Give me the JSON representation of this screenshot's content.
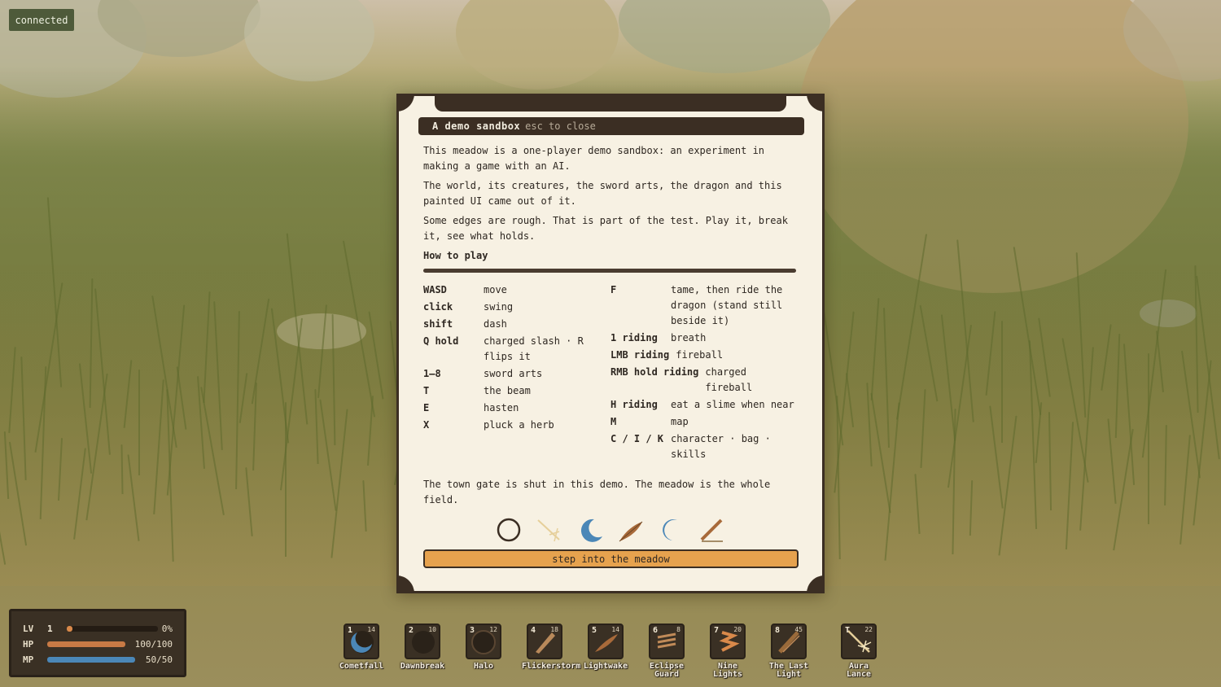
{
  "status": {
    "connection": "connected"
  },
  "dialog": {
    "title": "A demo sandbox",
    "close_hint": "esc to close",
    "paragraphs": [
      "This meadow is a one-player demo sandbox: an experiment in making a game with an AI.",
      "The world, its creatures, the sword arts, the dragon and this painted UI came out of it.",
      "Some edges are rough. That is part of the test. Play it, break it, see what holds."
    ],
    "howto_heading": "How to play",
    "controls_left": [
      {
        "key": "WASD",
        "desc": "move"
      },
      {
        "key": "click",
        "desc": "swing"
      },
      {
        "key": "shift",
        "desc": "dash"
      },
      {
        "key": "Q hold",
        "desc": "charged slash · R flips it"
      },
      {
        "key": "1–8",
        "desc": "sword arts"
      },
      {
        "key": "T",
        "desc": "the beam"
      },
      {
        "key": "E",
        "desc": "hasten"
      },
      {
        "key": "X",
        "desc": "pluck a herb"
      }
    ],
    "controls_right": [
      {
        "key": "F",
        "desc": "tame, then ride the dragon (stand still beside it)"
      },
      {
        "key": "1 riding",
        "desc": "breath"
      },
      {
        "key": "LMB riding",
        "desc": "fireball"
      },
      {
        "key": "RMB hold riding",
        "desc": "charged fireball"
      },
      {
        "key": "H riding",
        "desc": "eat a slime when near"
      },
      {
        "key": "M",
        "desc": "map"
      },
      {
        "key": "C / I / K",
        "desc": "character · bag · skills"
      }
    ],
    "footer": "The town gate is shut in this demo. The meadow is the whole field.",
    "icons": [
      "ring-icon",
      "starburst-icon",
      "crescent-icon",
      "feather-icon",
      "crescent-blue-icon",
      "quill-icon"
    ],
    "button": "step into the meadow"
  },
  "stats": {
    "level_label": "LV",
    "level": "1",
    "xp_percent": 0,
    "xp_text": "0%",
    "hp_label": "HP",
    "hp_text": "100/100",
    "hp_fraction": 1,
    "mp_label": "MP",
    "mp_text": "50/50",
    "mp_fraction": 1
  },
  "skills": [
    {
      "slot": "1",
      "cost": "14",
      "name": "Cometfall",
      "icon": "comet-icon"
    },
    {
      "slot": "2",
      "cost": "10",
      "name": "Dawnbreak",
      "icon": "dawn-icon"
    },
    {
      "slot": "3",
      "cost": "12",
      "name": "Halo",
      "icon": "halo-icon"
    },
    {
      "slot": "4",
      "cost": "18",
      "name": "Flickerstorm",
      "icon": "flicker-icon"
    },
    {
      "slot": "5",
      "cost": "14",
      "name": "Lightwake",
      "icon": "lightwake-icon"
    },
    {
      "slot": "6",
      "cost": "8",
      "name": "Eclipse Guard",
      "icon": "eclipse-icon"
    },
    {
      "slot": "7",
      "cost": "20",
      "name": "Nine Lights",
      "icon": "nine-lights-icon"
    },
    {
      "slot": "8",
      "cost": "45",
      "name": "The Last Light",
      "icon": "last-light-icon"
    },
    {
      "slot": "T",
      "cost": "22",
      "name": "Aura Lance",
      "icon": "lance-icon"
    }
  ],
  "colors": {
    "panel_dark": "#3b2e23",
    "parchment": "#f7f1e3",
    "button": "#e6a24e",
    "hp": "#c87a45",
    "mp": "#4b87b7",
    "xp": "#d9894a"
  }
}
